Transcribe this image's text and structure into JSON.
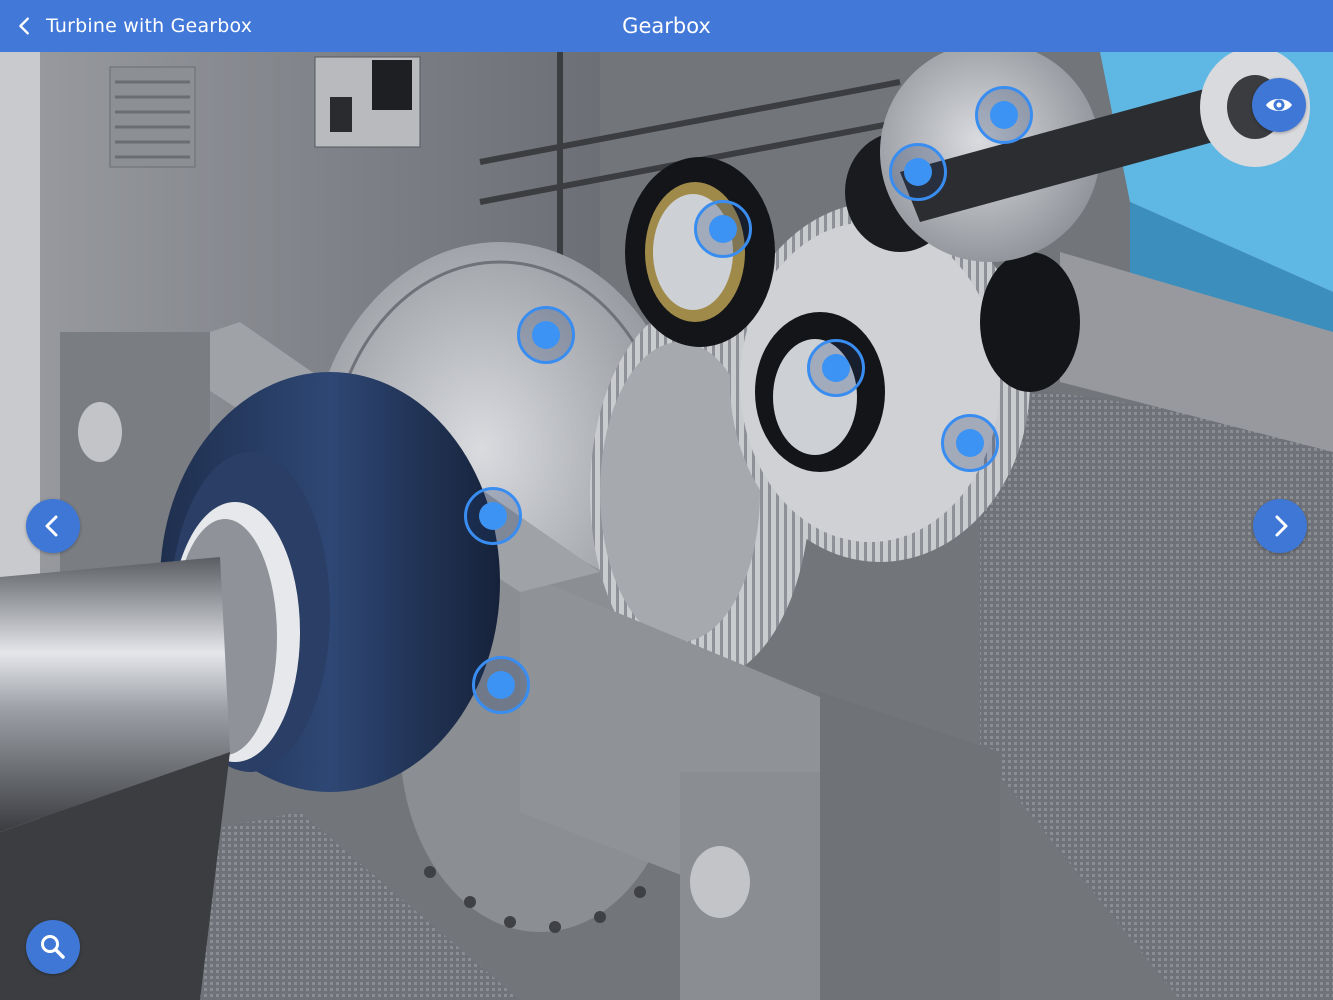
{
  "header": {
    "back_label": "Turbine with Gearbox",
    "title": "Gearbox"
  },
  "icons": {
    "back": "chevron-left-icon",
    "visibility": "eye-icon",
    "previous": "chevron-left-icon",
    "next": "chevron-right-icon",
    "search": "magnifier-icon"
  },
  "colors": {
    "header": "#4278d8",
    "accent": "#3c93f3",
    "button": "#3f77d6"
  }
}
